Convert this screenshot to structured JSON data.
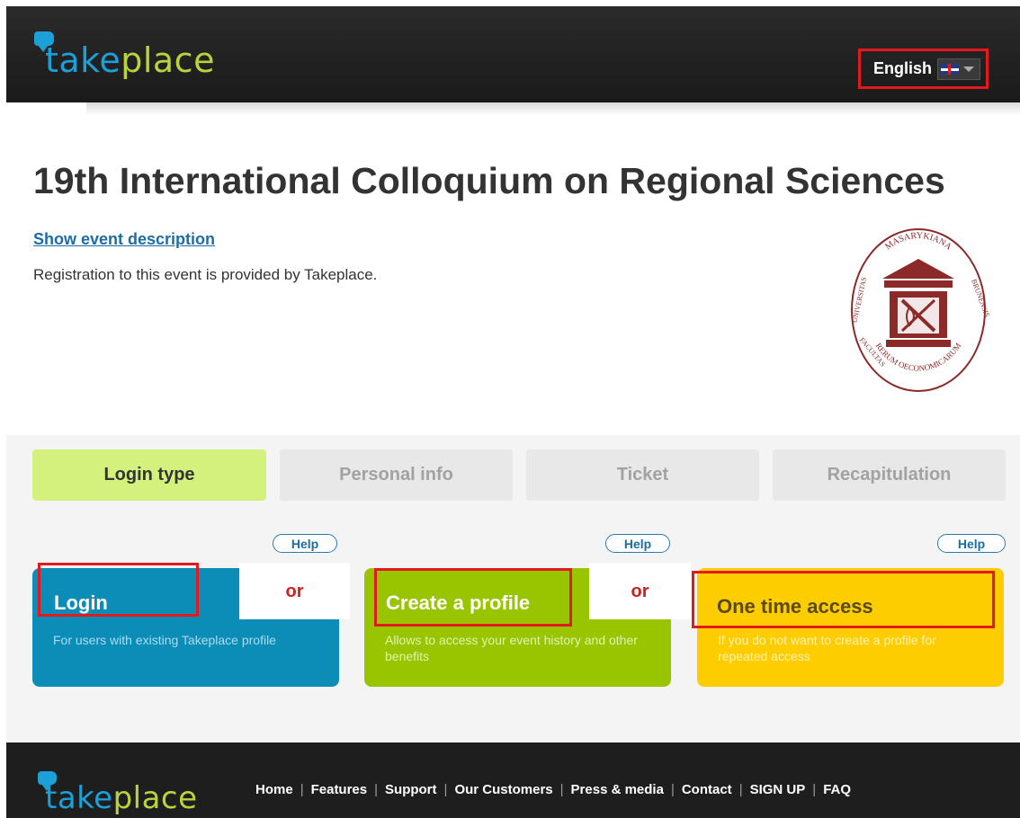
{
  "header": {
    "logo": {
      "part1": "take",
      "part2": "place"
    },
    "language": {
      "label": "English",
      "flag": "uk-flag-icon"
    }
  },
  "event": {
    "title": "19th International Colloquium on Regional Sciences",
    "show_description": "Show event description",
    "registration_text": "Registration to this event is provided by Takeplace.",
    "seal": {
      "top": "MASARYKIANA",
      "left": "UNIVERSITAS",
      "right": "BRUNENSIS",
      "bottom": "RERUM OECONOMICARUM",
      "bottom_left": "FACULTAS"
    }
  },
  "steps": [
    {
      "label": "Login type",
      "active": true
    },
    {
      "label": "Personal info",
      "active": false
    },
    {
      "label": "Ticket",
      "active": false
    },
    {
      "label": "Recapitulation",
      "active": false
    }
  ],
  "options": {
    "help_label": "Help",
    "or_label": "or",
    "login": {
      "title": "Login",
      "description": "For users with existing Takeplace profile"
    },
    "create": {
      "title": "Create a profile",
      "description": "Allows to access your event history and other benefits"
    },
    "onetime": {
      "title": "One time access",
      "description": "If you do not want to create a profile for repeated access"
    }
  },
  "footer": {
    "logo": {
      "part1": "take",
      "part2": "place"
    },
    "nav": [
      "Home",
      "Features",
      "Support",
      "Our Customers",
      "Press & media",
      "Contact",
      "SIGN UP",
      "FAQ"
    ]
  },
  "colors": {
    "header_bg": "#222222",
    "logo_blue": "#1ba0d8",
    "logo_green": "#b9d43a",
    "active_step": "#d3f17c",
    "login_card": "#0c8db7",
    "create_card": "#99c500",
    "onetime_card": "#fecd00",
    "highlight": "#e3191e",
    "seal": "#8c2a2a"
  }
}
